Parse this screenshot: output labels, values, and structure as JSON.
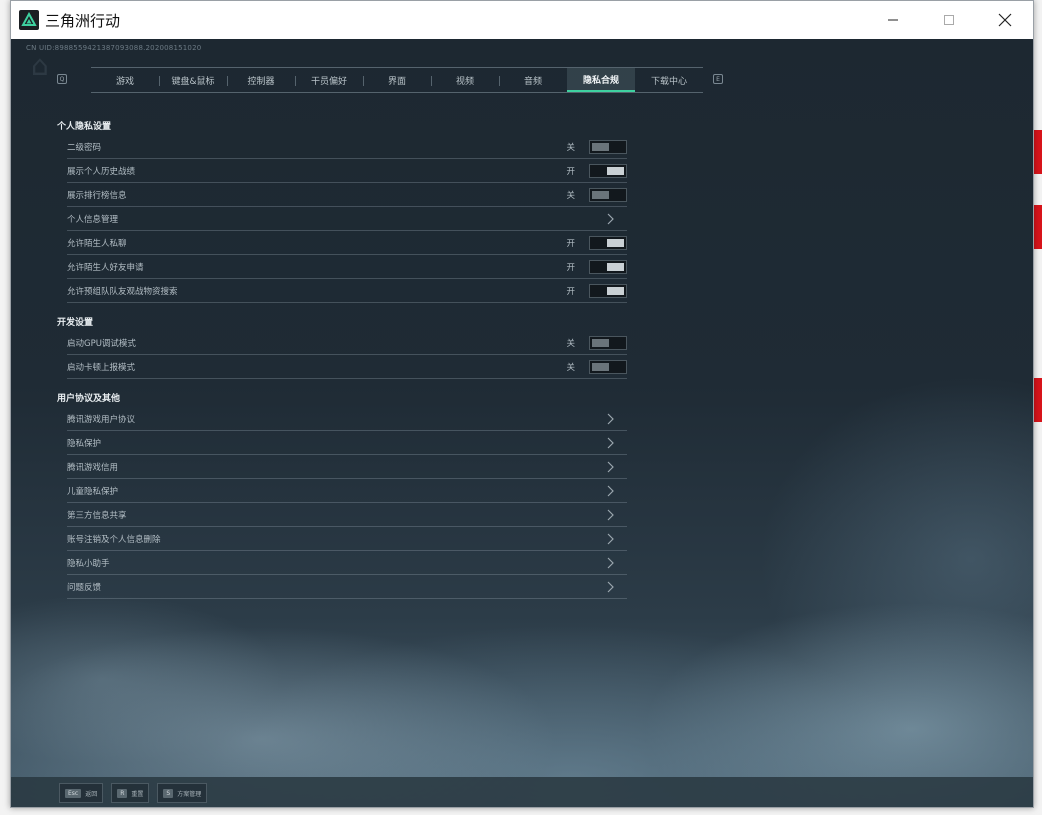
{
  "window": {
    "title": "三角洲行动"
  },
  "game": {
    "uid": "CN UID:8988559421387093088.202008151020",
    "tabs": [
      {
        "label": "游戏"
      },
      {
        "label": "键盘&鼠标"
      },
      {
        "label": "控制器"
      },
      {
        "label": "干员偏好"
      },
      {
        "label": "界面"
      },
      {
        "label": "视频"
      },
      {
        "label": "音频"
      },
      {
        "label": "隐私合规",
        "active": true
      },
      {
        "label": "下载中心"
      }
    ],
    "tab_prev_key": "Q",
    "tab_next_key": "E",
    "sections": {
      "privacy": {
        "title": "个人隐私设置",
        "rows": [
          {
            "label": "二级密码",
            "state": "关"
          },
          {
            "label": "展示个人历史战绩",
            "state": "开"
          },
          {
            "label": "展示排行榜信息",
            "state": "关"
          },
          {
            "label": "个人信息管理"
          },
          {
            "label": "允许陌生人私聊",
            "state": "开"
          },
          {
            "label": "允许陌生人好友申请",
            "state": "开"
          },
          {
            "label": "允许预组队队友观战物资搜索",
            "state": "开"
          }
        ]
      },
      "dev": {
        "title": "开发设置",
        "rows": [
          {
            "label": "启动GPU调试模式",
            "state": "关"
          },
          {
            "label": "启动卡顿上报模式",
            "state": "关"
          }
        ]
      },
      "agreements": {
        "title": "用户协议及其他",
        "rows": [
          {
            "label": "腾讯游戏用户协议"
          },
          {
            "label": "隐私保护"
          },
          {
            "label": "腾讯游戏信用"
          },
          {
            "label": "儿童隐私保护"
          },
          {
            "label": "第三方信息共享"
          },
          {
            "label": "账号注销及个人信息删除"
          },
          {
            "label": "隐私小助手"
          },
          {
            "label": "问题反馈"
          }
        ]
      }
    },
    "bottom_hints": [
      {
        "key": "Esc",
        "label": "返回"
      },
      {
        "key": "R",
        "label": "重置"
      },
      {
        "key": "S",
        "label": "方案管理"
      }
    ]
  },
  "colors": {
    "accent": "#3ed1a0",
    "background": "#1c252d",
    "red_tab": "#d8141b"
  }
}
